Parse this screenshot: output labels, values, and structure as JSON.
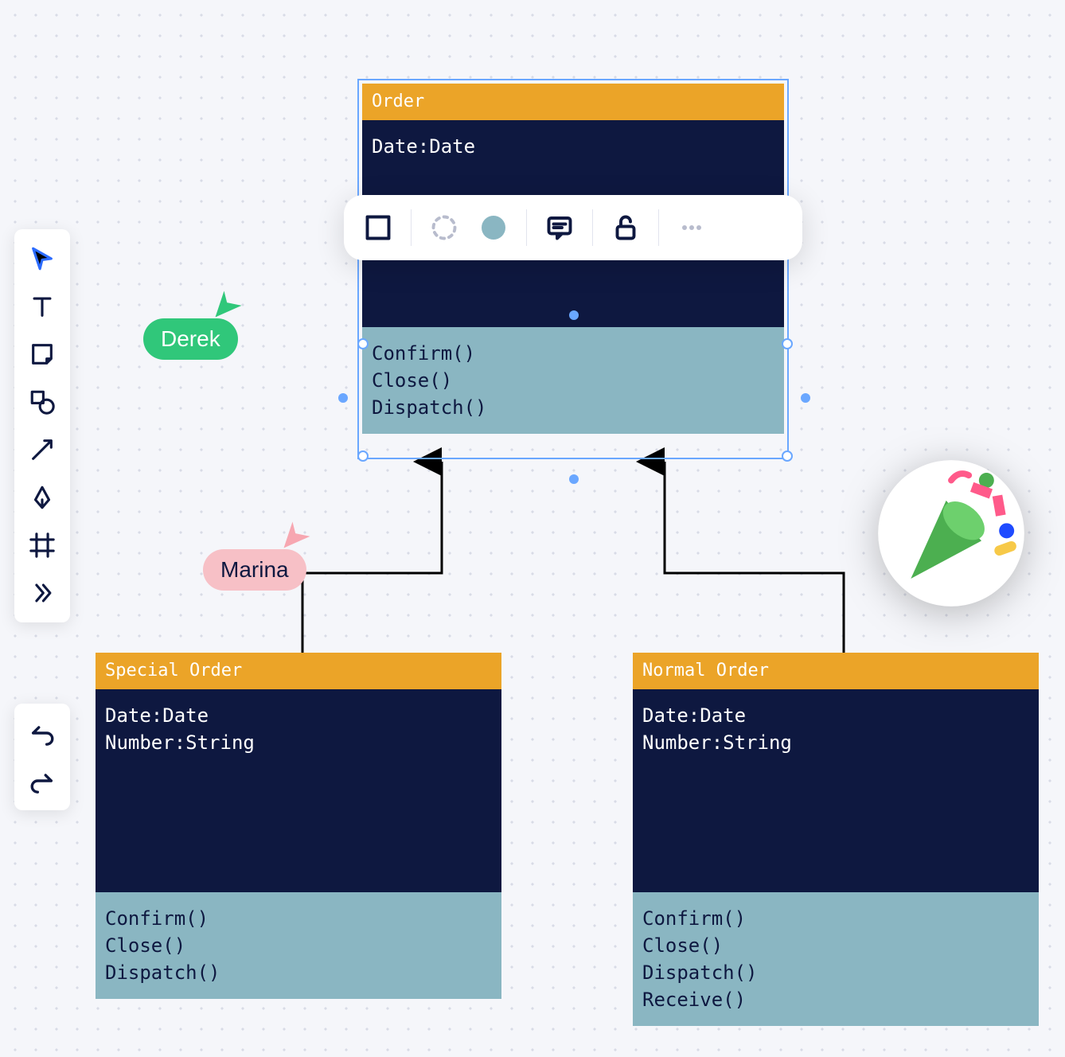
{
  "collaborators": {
    "derek": {
      "name": "Derek",
      "color": "#30c77a"
    },
    "marina": {
      "name": "Marina",
      "color": "#f7c0c6"
    }
  },
  "toolbar_main": [
    {
      "name": "select-tool",
      "active": true
    },
    {
      "name": "text-tool",
      "active": false
    },
    {
      "name": "note-tool",
      "active": false
    },
    {
      "name": "shape-tool",
      "active": false
    },
    {
      "name": "arrow-tool",
      "active": false
    },
    {
      "name": "pen-tool",
      "active": false
    },
    {
      "name": "frame-tool",
      "active": false
    },
    {
      "name": "more-tool",
      "active": false
    }
  ],
  "toolbar_history": [
    {
      "name": "undo-button"
    },
    {
      "name": "redo-button"
    }
  ],
  "context_bar": {
    "items": [
      {
        "name": "stroke-style-button"
      },
      {
        "name": "border-style-button"
      },
      {
        "name": "fill-color-button",
        "fill": "#8ab6c2"
      },
      {
        "name": "comment-button"
      },
      {
        "name": "lock-button"
      },
      {
        "name": "more-options-button"
      }
    ]
  },
  "classes": {
    "order": {
      "title": "Order",
      "attrs": [
        "Date:Date"
      ],
      "methods": [
        "Confirm()",
        "Close()",
        "Dispatch()"
      ],
      "selected": true
    },
    "special_order": {
      "title": "Special Order",
      "attrs": [
        "Date:Date",
        "Number:String"
      ],
      "methods": [
        "Confirm()",
        "Close()",
        "Dispatch()"
      ]
    },
    "normal_order": {
      "title": "Normal Order",
      "attrs": [
        "Date:Date",
        "Number:String"
      ],
      "methods": [
        "Confirm()",
        "Close()",
        "Dispatch()",
        "Receive()"
      ]
    }
  },
  "connectors": [
    {
      "from": "special_order",
      "to": "order",
      "kind": "inheritance"
    },
    {
      "from": "normal_order",
      "to": "order",
      "kind": "inheritance"
    }
  ],
  "sticker": {
    "name": "party-popper-sticker"
  }
}
